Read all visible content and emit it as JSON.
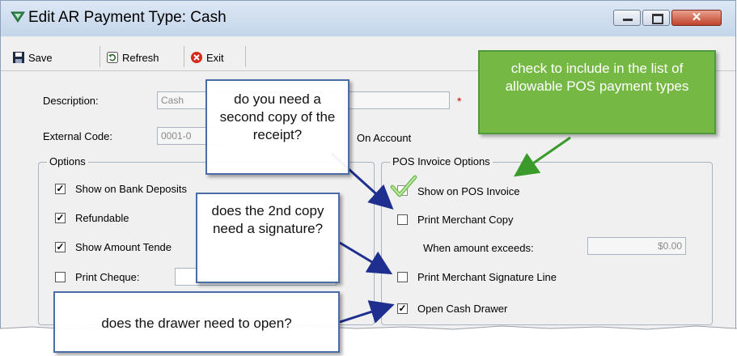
{
  "window": {
    "title": "Edit AR Payment Type: Cash",
    "controls": {
      "close": "✕"
    }
  },
  "toolbar": {
    "save_label": "Save",
    "refresh_label": "Refresh",
    "exit_label": "Exit"
  },
  "form": {
    "description_label": "Description:",
    "description_value": "Cash",
    "external_code_label": "External Code:",
    "external_code_value": "0001-0",
    "on_account_label": "On Account",
    "required_marker": "*"
  },
  "options": {
    "title": "Options",
    "items": [
      {
        "label": "Show on Bank Deposits",
        "checked": true
      },
      {
        "label": "Refundable",
        "checked": true
      },
      {
        "label": "Show Amount Tende",
        "checked": true
      },
      {
        "label": "Print Cheque:",
        "checked": false
      }
    ]
  },
  "pos_options": {
    "title": "POS Invoice Options",
    "items": [
      {
        "label": "Show on POS Invoice",
        "checked": true
      },
      {
        "label": "Print Merchant Copy",
        "checked": false
      },
      {
        "label": "Print Merchant Signature Line",
        "checked": false
      },
      {
        "label": "Open Cash Drawer",
        "checked": true
      }
    ],
    "amount_label": "When amount exceeds:",
    "amount_value": "$0.00"
  },
  "callouts": {
    "second_copy": "do you need a second copy of the receipt?",
    "signature": "does the 2nd copy need a signature?",
    "drawer": "does the drawer need to open?",
    "pos_include": "check to include in the list of allowable POS payment types"
  },
  "colors": {
    "callout_border": "#4a6da6",
    "arrow_blue": "#1f2f8f",
    "callout_green": "#75b843",
    "arrow_green": "#3a9a2a"
  }
}
